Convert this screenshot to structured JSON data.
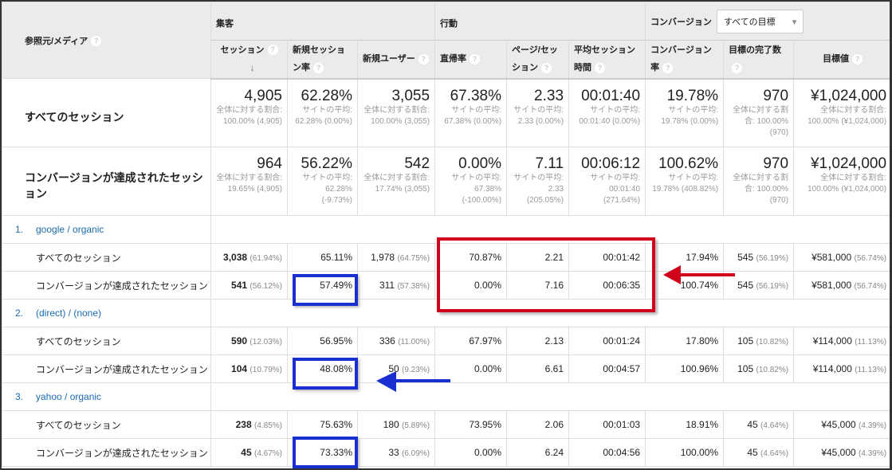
{
  "header": {
    "dimension": "参照元/メディア",
    "group_acquisition": "集客",
    "group_behavior": "行動",
    "group_conversion": "コンバージョン",
    "goal_select": "すべての目標",
    "columns": [
      "セッション",
      "新規セッション率",
      "新規ユーザー",
      "直帰率",
      "ページ/セッション",
      "平均セッション時間",
      "コンバージョン率",
      "目標の完了数",
      "目標値"
    ]
  },
  "summary": [
    {
      "label": "すべてのセッション",
      "cells": [
        {
          "v": "4,905",
          "s": "全体に対する割合: 100.00% (4,905)"
        },
        {
          "v": "62.28%",
          "s": "サイトの平均: 62.28% (0.00%)"
        },
        {
          "v": "3,055",
          "s": "全体に対する割合: 100.00% (3,055)"
        },
        {
          "v": "67.38%",
          "s": "サイトの平均: 67.38% (0.00%)"
        },
        {
          "v": "2.33",
          "s": "サイトの平均: 2.33 (0.00%)"
        },
        {
          "v": "00:01:40",
          "s": "サイトの平均: 00:01:40 (0.00%)"
        },
        {
          "v": "19.78%",
          "s": "サイトの平均: 19.78% (0.00%)"
        },
        {
          "v": "970",
          "s": "全体に対する割合: 100.00% (970)"
        },
        {
          "v": "¥1,024,000",
          "s": "全体に対する割合: 100.00% (¥1,024,000)"
        }
      ]
    },
    {
      "label": "コンバージョンが達成されたセッション",
      "cells": [
        {
          "v": "964",
          "s": "全体に対する割合: 19.65% (4,905)"
        },
        {
          "v": "56.22%",
          "s": "サイトの平均: 62.28% (-9.73%)"
        },
        {
          "v": "542",
          "s": "全体に対する割合: 17.74% (3,055)"
        },
        {
          "v": "0.00%",
          "s": "サイトの平均: 67.38% (-100.00%)"
        },
        {
          "v": "7.11",
          "s": "サイトの平均: 2.33 (205.05%)"
        },
        {
          "v": "00:06:12",
          "s": "サイトの平均: 00:01:40 (271.64%)"
        },
        {
          "v": "100.62%",
          "s": "サイトの平均: 19.78% (408.82%)"
        },
        {
          "v": "970",
          "s": "全体に対する割合: 100.00% (970)"
        },
        {
          "v": "¥1,024,000",
          "s": "全体に対する割合: 100.00% (¥1,024,000)"
        }
      ]
    }
  ],
  "groups": [
    {
      "num": "1.",
      "source": "google / organic",
      "rows": [
        {
          "label": "すべてのセッション",
          "sessions": "3,038",
          "sessions_pct": "(61.94%)",
          "new_rate": "65.11%",
          "new_users": "1,978",
          "new_users_pct": "(64.75%)",
          "bounce": "70.87%",
          "pages": "2.21",
          "duration": "00:01:42",
          "conv": "17.94%",
          "goals": "545",
          "goals_pct": "(56.19%)",
          "value": "¥581,000",
          "value_pct": "(56.74%)"
        },
        {
          "label": "コンバージョンが達成されたセッション",
          "sessions": "541",
          "sessions_pct": "(56.12%)",
          "new_rate": "57.49%",
          "new_users": "311",
          "new_users_pct": "(57.38%)",
          "bounce": "0.00%",
          "pages": "7.16",
          "duration": "00:06:35",
          "conv": "100.74%",
          "goals": "545",
          "goals_pct": "(56.19%)",
          "value": "¥581,000",
          "value_pct": "(56.74%)"
        }
      ]
    },
    {
      "num": "2.",
      "source": "(direct) / (none)",
      "rows": [
        {
          "label": "すべてのセッション",
          "sessions": "590",
          "sessions_pct": "(12.03%)",
          "new_rate": "56.95%",
          "new_users": "336",
          "new_users_pct": "(11.00%)",
          "bounce": "67.97%",
          "pages": "2.13",
          "duration": "00:01:24",
          "conv": "17.80%",
          "goals": "105",
          "goals_pct": "(10.82%)",
          "value": "¥114,000",
          "value_pct": "(11.13%)"
        },
        {
          "label": "コンバージョンが達成されたセッション",
          "sessions": "104",
          "sessions_pct": "(10.79%)",
          "new_rate": "48.08%",
          "new_users": "50",
          "new_users_pct": "(9.23%)",
          "bounce": "0.00%",
          "pages": "6.61",
          "duration": "00:04:57",
          "conv": "100.96%",
          "goals": "105",
          "goals_pct": "(10.82%)",
          "value": "¥114,000",
          "value_pct": "(11.13%)"
        }
      ]
    },
    {
      "num": "3.",
      "source": "yahoo / organic",
      "rows": [
        {
          "label": "すべてのセッション",
          "sessions": "238",
          "sessions_pct": "(4.85%)",
          "new_rate": "75.63%",
          "new_users": "180",
          "new_users_pct": "(5.89%)",
          "bounce": "73.95%",
          "pages": "2.06",
          "duration": "00:01:03",
          "conv": "18.91%",
          "goals": "45",
          "goals_pct": "(4.64%)",
          "value": "¥45,000",
          "value_pct": "(4.39%)"
        },
        {
          "label": "コンバージョンが達成されたセッション",
          "sessions": "45",
          "sessions_pct": "(4.67%)",
          "new_rate": "73.33%",
          "new_users": "33",
          "new_users_pct": "(6.09%)",
          "bounce": "0.00%",
          "pages": "6.24",
          "duration": "00:04:56",
          "conv": "100.00%",
          "goals": "45",
          "goals_pct": "(4.64%)",
          "value": "¥45,000",
          "value_pct": "(4.39%)"
        }
      ]
    }
  ],
  "annotations": {
    "box_color": "#d0021b",
    "blue_color": "#1a2fd0"
  }
}
